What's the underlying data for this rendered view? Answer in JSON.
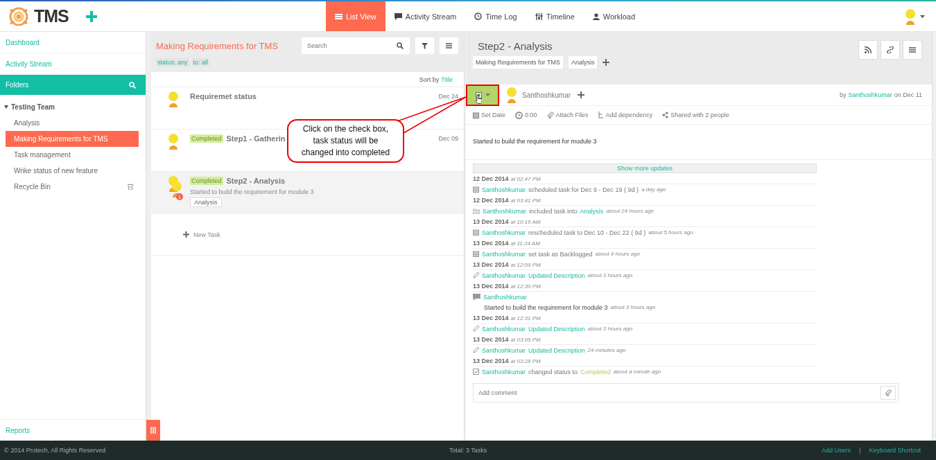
{
  "header": {
    "logo": "TMS",
    "tabs": [
      {
        "label": "List View",
        "kind": "list",
        "selected": true
      },
      {
        "label": "Activity Stream",
        "kind": "comment",
        "selected": false
      },
      {
        "label": "Time Log",
        "kind": "clock",
        "selected": false
      },
      {
        "label": "Timeline",
        "kind": "sliders",
        "selected": false
      },
      {
        "label": "Workload",
        "kind": "person",
        "selected": false
      }
    ]
  },
  "sidebar": {
    "links": [
      "Dashboard",
      "Activity Stream"
    ],
    "folders_title": "Folders",
    "tree": [
      {
        "label": "Testing Team",
        "expanded": true,
        "children": [
          {
            "label": "Analysis",
            "selected": false
          },
          {
            "label": "Making Requirements for TMS",
            "selected": true
          },
          {
            "label": "Task management",
            "selected": false
          },
          {
            "label": "Wrike status of new feature",
            "selected": false
          },
          {
            "label": "Recycle Bin",
            "kind": "trash",
            "selected": false
          }
        ]
      }
    ],
    "footer_link": "Reports"
  },
  "task_list": {
    "title": "Making Requirements for TMS",
    "search": {
      "placeholder": "Search"
    },
    "filters": [
      "status: any",
      "to: all"
    ],
    "sort_label": "Sort by",
    "sort_value": "Title",
    "tasks": [
      {
        "title": "Requiremet status",
        "date": "Dec 24",
        "selected": false
      },
      {
        "title": "Step1 - Gatherin",
        "status": "Completed",
        "date": "Dec 09",
        "selected": false
      },
      {
        "title": "Step2 - Analysis",
        "status": "Completed",
        "description": "Started to build the requirement for module 3",
        "tag": "Analysis",
        "selected": true,
        "shared": true,
        "badge": "1"
      }
    ],
    "new_task": "New Task"
  },
  "task_detail": {
    "title": "Step2 - Analysis",
    "tags": [
      "Making Requirements for TMS",
      "Analysis"
    ],
    "completed": true,
    "assignee": "Santhoshkumar",
    "by_label": "by",
    "author": "Santhoshkumar",
    "on_label": "on Dec 11",
    "toolbar": [
      {
        "label": "Set Date",
        "kind": "calendar"
      },
      {
        "label": "0:00",
        "kind": "clock"
      },
      {
        "label": "Attach Files",
        "kind": "clip"
      },
      {
        "label": "Add dependency",
        "kind": "dependency"
      },
      {
        "label": "Shared with 2 people",
        "kind": "share"
      }
    ],
    "description": "Started to build the requirement for module 3",
    "show_more": "Show more updates",
    "updates": [
      {
        "date": "12 Dec 2014",
        "time": "at 02:47 PM",
        "kind": "calendar",
        "parts": [
          {
            "text": "Santhoshkumar",
            "kind": "user"
          },
          {
            "text": "scheduled task for Dec 9 - Dec 19 ( 9d )",
            "kind": "plain"
          }
        ],
        "ago": "a day ago"
      },
      {
        "date": "12 Dec 2014",
        "time": "at 03:41 PM",
        "kind": "folder",
        "parts": [
          {
            "text": "Santhoshkumar",
            "kind": "user"
          },
          {
            "text": "included task into",
            "kind": "plain"
          },
          {
            "text": "Analysis",
            "kind": "link"
          }
        ],
        "ago": "about 24 hours ago"
      },
      {
        "date": "13 Dec 2014",
        "time": "at 10:16 AM",
        "kind": "calendar",
        "parts": [
          {
            "text": "Santhoshkumar",
            "kind": "user"
          },
          {
            "text": "rescheduled task to Dec 10 - Dec 22 ( 9d )",
            "kind": "plain"
          }
        ],
        "ago": "about 5 hours ago"
      },
      {
        "date": "13 Dec 2014",
        "time": "at 11:24 AM",
        "kind": "calendar",
        "parts": [
          {
            "text": "Santhoshkumar",
            "kind": "user"
          },
          {
            "text": "set task as Backlogged",
            "kind": "plain"
          }
        ],
        "ago": "about 4 hours ago"
      },
      {
        "date": "13 Dec 2014",
        "time": "at 12:09 PM",
        "kind": "pencil",
        "parts": [
          {
            "text": "Santhoshkumar",
            "kind": "user"
          },
          {
            "text": "Updated Description",
            "kind": "link"
          }
        ],
        "ago": "about 3 hours ago"
      },
      {
        "date": "13 Dec 2014",
        "time": "at 12:30 PM",
        "kind": "comment",
        "parts": [
          {
            "text": "Santhoshkumar",
            "kind": "user"
          }
        ],
        "comment": "Started to build the requirement for module 3",
        "ago": "about 3 hours ago"
      },
      {
        "date": "13 Dec 2014",
        "time": "at 12:31 PM",
        "kind": "pencil",
        "parts": [
          {
            "text": "Santhoshkumar",
            "kind": "user"
          },
          {
            "text": "Updated Description",
            "kind": "link"
          }
        ],
        "ago": "about 3 hours ago"
      },
      {
        "date": "13 Dec 2014",
        "time": "at 03:05 PM",
        "kind": "pencil",
        "parts": [
          {
            "text": "Santhoshkumar",
            "kind": "user"
          },
          {
            "text": "Updated Description",
            "kind": "link"
          }
        ],
        "ago": "24 minutes ago"
      },
      {
        "date": "13 Dec 2014",
        "time": "at 03:28 PM",
        "kind": "check",
        "parts": [
          {
            "text": "Santhoshkumar",
            "kind": "user"
          },
          {
            "text": "changed status to",
            "kind": "plain"
          },
          {
            "text": "Completed",
            "kind": "status"
          }
        ],
        "ago": "about a minute ago"
      }
    ],
    "comment_field": {
      "placeholder": "Add comment"
    }
  },
  "callout": {
    "lines": [
      "Click on the check  box,",
      "task status will be",
      "changed into completed"
    ]
  },
  "footer": {
    "copyright": "© 2014 Protech, All Rights Reserved",
    "total": "Total: 3 Tasks",
    "links": [
      "Add Users",
      "Keyboard Shortcut"
    ],
    "separator": "|"
  }
}
